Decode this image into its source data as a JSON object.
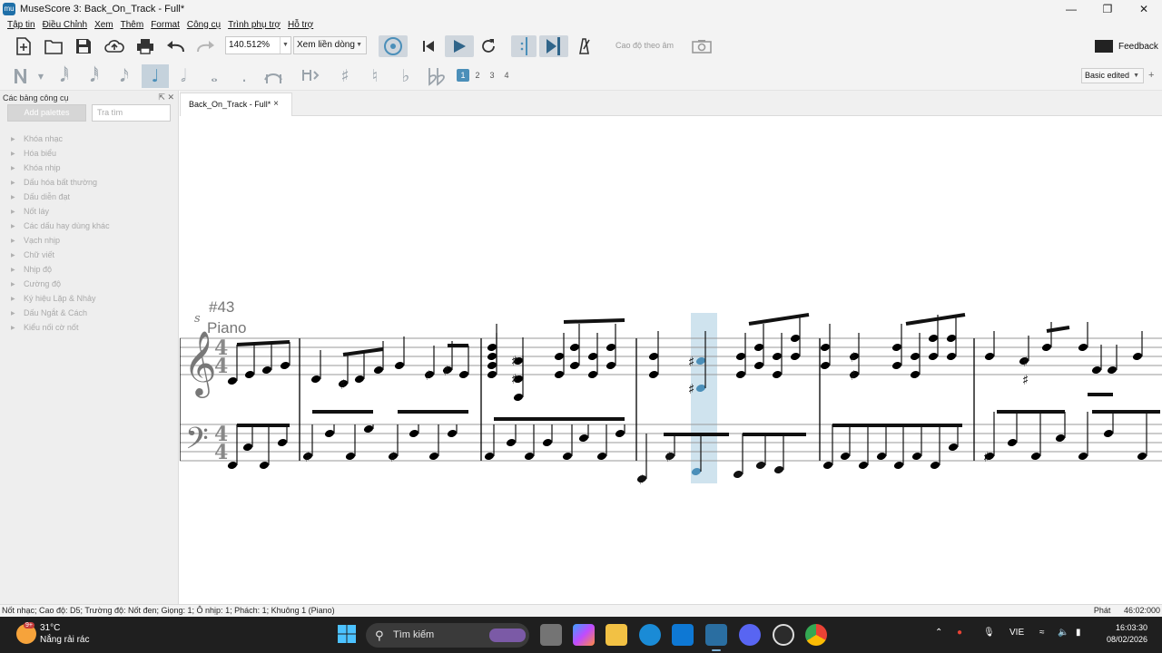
{
  "window": {
    "title": "MuseScore 3: Back_On_Track - Full*",
    "app_icon": "mu",
    "buttons": [
      "minimize-icon",
      "restore-icon",
      "close-icon"
    ]
  },
  "menu": [
    "Tập tin",
    "Điều Chỉnh",
    "Xem",
    "Thêm",
    "Format",
    "Công cụ",
    "Trình phụ trợ",
    "Hỗ trợ"
  ],
  "toolbar": {
    "zoom": "140.512%",
    "view_mode": "Xem liền dòng",
    "pitch_label": "Cao độ theo âm",
    "feedback": "Feedback"
  },
  "note_input": {
    "voices": [
      "1",
      "2",
      "3",
      "4"
    ],
    "active_voice": "1",
    "workspace": "Basic edited",
    "plus": "+"
  },
  "palette": {
    "title": "Các bảng công cụ",
    "add_button": "Add palettes",
    "search_placeholder": "Tra tìm",
    "items": [
      "Khóa nhạc",
      "Hóa biểu",
      "Khóa nhịp",
      "Dấu hóa bất thường",
      "Dấu diễn đạt",
      "Nốt láy",
      "Các dấu hay dùng khác",
      "Vạch nhịp",
      "Chữ viết",
      "Nhịp độ",
      "Cường độ",
      "Ký hiệu Lặp & Nhảy",
      "Dấu Ngắt & Cách",
      "Kiểu nối cờ nốt"
    ]
  },
  "score": {
    "tab": "Back_On_Track - Full*",
    "tab_close": "×",
    "measure_number": "#43",
    "instrument": "Piano",
    "segno": "s",
    "time_signature": "4",
    "accent_color": "#4b8fb9",
    "selection_color": "#cfe3ee"
  },
  "status": {
    "left": "Nốt nhạc; Cao độ: D5; Trường độ: Nốt đen; Giọng: 1;  Ô nhịp: 1; Phách: 1; Khuông 1 (Piano)",
    "mode": "Phát",
    "position": "46:02:000"
  },
  "taskbar": {
    "temperature": "31°C",
    "weather": "Nắng rải rác",
    "weather_badge": "9+",
    "search": "Tìm kiếm",
    "language": "VIE",
    "time": "16:03:30",
    "date": "08/02/2026"
  }
}
